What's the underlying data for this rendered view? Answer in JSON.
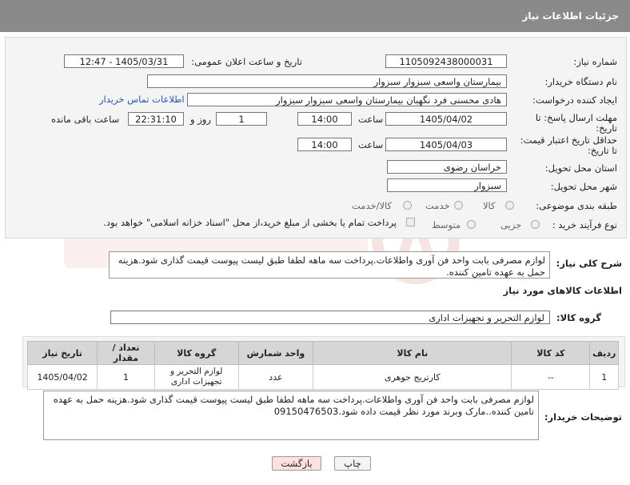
{
  "header": {
    "title": "جزئیات اطلاعات نیاز"
  },
  "form": {
    "need_number": {
      "label": "شماره نیاز:",
      "value": "1105092438000031"
    },
    "announce": {
      "label": "تاریخ و ساعت اعلان عمومی:",
      "value": "1405/03/31 - 12:47"
    },
    "buyer_org": {
      "label": "نام دستگاه خریدار:",
      "value": "بیمارستان واسعی سبزوار سبزوار"
    },
    "creator": {
      "label": "ایجاد کننده درخواست:",
      "value": "هادی محسنی فرد نگهبان بیمارستان واسعی سبزوار سبزوار",
      "contact_link": "اطلاعات تماس خریدار"
    },
    "reply_deadline": {
      "label_line1": "مهلت ارسال پاسخ: تا",
      "label_line2": "تاریخ:",
      "date": "1405/04/02",
      "time_label": "ساعت",
      "time": "14:00",
      "days": "1",
      "days_label": "روز و",
      "remain": "22:31:10",
      "remain_label": "ساعت باقی مانده"
    },
    "price_validity": {
      "label_line1": "حداقل تاریخ اعتبار قیمت:",
      "label_line2": "تا تاریخ:",
      "date": "1405/04/03",
      "time_label": "ساعت",
      "time": "14:00"
    },
    "province": {
      "label": "استان محل تحویل:",
      "value": "خراسان رضوی"
    },
    "city": {
      "label": "شهر محل تحویل:",
      "value": "سبزوار"
    },
    "category": {
      "label": "طبقه بندی موضوعی:",
      "options": [
        "کالا",
        "خدمت",
        "کالا/خدمت"
      ]
    },
    "process": {
      "label": "نوع فرآیند خرید :",
      "options": [
        "جزیی",
        "متوسط"
      ],
      "payment_note": "پرداخت تمام یا بخشی از مبلغ خرید،از محل \"اسناد خزانه اسلامی\" خواهد بود."
    }
  },
  "description": {
    "label": "شرح کلی نیاز:",
    "text": "لوازم مصرفی بابت واحد فن آوری واطلاعات.پرداخت سه ماهه لطفا طبق لیست پیوست قیمت گذاری شود.هزینه حمل به عهده تامین کننده."
  },
  "items_section": {
    "title": "اطلاعات کالاهای مورد نیاز",
    "group_label": "گروه کالا:",
    "group_value": "لوازم التحریر و تجهیزات اداری"
  },
  "table": {
    "headers": [
      "ردیف",
      "کد کالا",
      "نام کالا",
      "واحد شمارش",
      "گروه کالا",
      "تعداد / مقدار",
      "تاریخ نیاز"
    ],
    "rows": [
      [
        "1",
        "--",
        "کارتریج جوهری",
        "عدد",
        "لوازم التحریر و تجهیزات اداری",
        "1",
        "1405/04/02"
      ]
    ]
  },
  "buyer_notes": {
    "label": "توضیحات خریدار:",
    "text": "لوازم مصرفی بابت واحد فن آوری واطلاعات.پرداخت سه ماهه لطفا طبق لیست پیوست قیمت گذاری شود.هزینه حمل به عهده تامین کننده..مارک وبرند مورد نظر قیمت داده شود.09150476503"
  },
  "buttons": {
    "print": "چاپ",
    "back": "بازگشت"
  }
}
